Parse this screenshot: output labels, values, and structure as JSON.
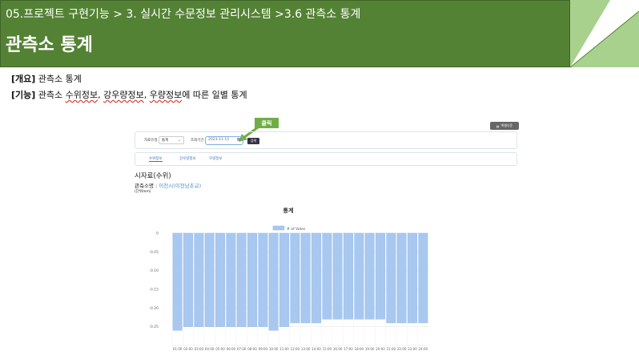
{
  "banner": {
    "breadcrumb": "05.프로젝트 구현기능 > 3. 실시간 수문정보 관리시스템 >3.6 관측소 통계",
    "title": "관측소 통계"
  },
  "doc": {
    "overview_tag": "[개요]",
    "overview_text": "관측소 통계",
    "feature_tag": "[기능]",
    "feature_text_1": "관측소 ",
    "feature_word_1": "수위정보",
    "feature_sep_1": ", ",
    "feature_word_2": "강우량정보",
    "feature_sep_2": ", ",
    "feature_word_3": "우량정보",
    "feature_text_2": "에 따른 일별 통계"
  },
  "app": {
    "excel_button": "엑셀다운",
    "callout": "클릭",
    "filter_type_label": "자료유형",
    "filter_type_value": "통계",
    "date_label": "조회기간",
    "date_value": "2023-11-15",
    "search_button": "검색",
    "tabs": [
      "수위정보",
      "강우량정보",
      "우량정보"
    ],
    "section_title": "시자료(수위)",
    "station_label": "관측소명 : ",
    "station_value": "이천시(이천남초교)",
    "unit": "(단위mm)",
    "chart_heading": "통계"
  },
  "colors": {
    "banner_green": "#548235",
    "callout_green": "#70ad47",
    "bar_fill": "#a8c8f0",
    "bar_stroke": "#8fb5e8"
  },
  "chart_data": {
    "type": "bar",
    "legend": [
      "# of Votes"
    ],
    "categories": [
      "01:00",
      "02:00",
      "03:00",
      "04:00",
      "05:00",
      "06:00",
      "07:00",
      "08:00",
      "09:00",
      "10:00",
      "11:00",
      "12:00",
      "13:00",
      "14:00",
      "15:00",
      "16:00",
      "17:00",
      "18:00",
      "19:00",
      "20:00",
      "21:00",
      "22:00",
      "23:00",
      "24:00"
    ],
    "series": [
      {
        "name": "# of Votes",
        "values": [
          -0.26,
          -0.25,
          -0.25,
          -0.25,
          -0.25,
          -0.25,
          -0.25,
          -0.25,
          -0.25,
          -0.26,
          -0.25,
          -0.24,
          -0.24,
          -0.24,
          -0.23,
          -0.23,
          -0.23,
          -0.23,
          -0.23,
          -0.23,
          -0.24,
          -0.24,
          -0.24,
          -0.24
        ]
      }
    ],
    "yticks": [
      "0",
      "-0.05",
      "-0.10",
      "-0.15",
      "-0.20",
      "-0.25"
    ],
    "ylim": [
      -0.3,
      0
    ],
    "grid": true,
    "legend_position": "top"
  }
}
